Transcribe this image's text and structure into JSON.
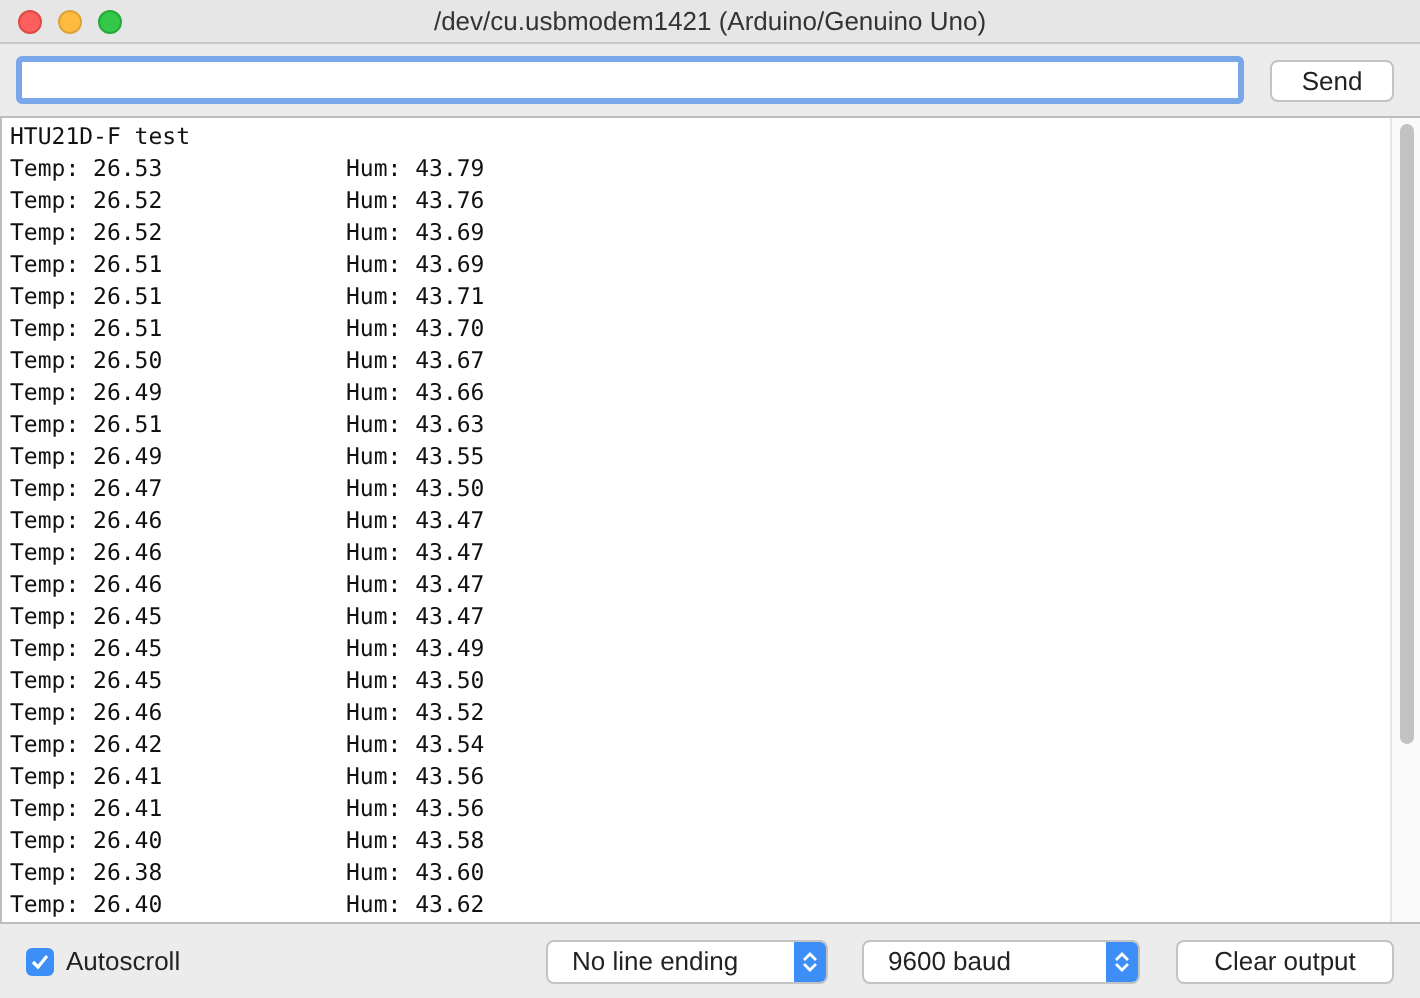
{
  "window": {
    "title": "/dev/cu.usbmodem1421 (Arduino/Genuino Uno)"
  },
  "send_button": "Send",
  "output": {
    "header": "HTU21D-F test",
    "rows": [
      {
        "temp": "Temp: 26.53",
        "hum": "Hum: 43.79"
      },
      {
        "temp": "Temp: 26.52",
        "hum": "Hum: 43.76"
      },
      {
        "temp": "Temp: 26.52",
        "hum": "Hum: 43.69"
      },
      {
        "temp": "Temp: 26.51",
        "hum": "Hum: 43.69"
      },
      {
        "temp": "Temp: 26.51",
        "hum": "Hum: 43.71"
      },
      {
        "temp": "Temp: 26.51",
        "hum": "Hum: 43.70"
      },
      {
        "temp": "Temp: 26.50",
        "hum": "Hum: 43.67"
      },
      {
        "temp": "Temp: 26.49",
        "hum": "Hum: 43.66"
      },
      {
        "temp": "Temp: 26.51",
        "hum": "Hum: 43.63"
      },
      {
        "temp": "Temp: 26.49",
        "hum": "Hum: 43.55"
      },
      {
        "temp": "Temp: 26.47",
        "hum": "Hum: 43.50"
      },
      {
        "temp": "Temp: 26.46",
        "hum": "Hum: 43.47"
      },
      {
        "temp": "Temp: 26.46",
        "hum": "Hum: 43.47"
      },
      {
        "temp": "Temp: 26.46",
        "hum": "Hum: 43.47"
      },
      {
        "temp": "Temp: 26.45",
        "hum": "Hum: 43.47"
      },
      {
        "temp": "Temp: 26.45",
        "hum": "Hum: 43.49"
      },
      {
        "temp": "Temp: 26.45",
        "hum": "Hum: 43.50"
      },
      {
        "temp": "Temp: 26.46",
        "hum": "Hum: 43.52"
      },
      {
        "temp": "Temp: 26.42",
        "hum": "Hum: 43.54"
      },
      {
        "temp": "Temp: 26.41",
        "hum": "Hum: 43.56"
      },
      {
        "temp": "Temp: 26.41",
        "hum": "Hum: 43.56"
      },
      {
        "temp": "Temp: 26.40",
        "hum": "Hum: 43.58"
      },
      {
        "temp": "Temp: 26.38",
        "hum": "Hum: 43.60"
      },
      {
        "temp": "Temp: 26.40",
        "hum": "Hum: 43.62"
      }
    ]
  },
  "footer": {
    "autoscroll": {
      "label": "Autoscroll",
      "checked": true
    },
    "line_ending": "No line ending",
    "baud": "9600 baud",
    "clear_button": "Clear output"
  }
}
